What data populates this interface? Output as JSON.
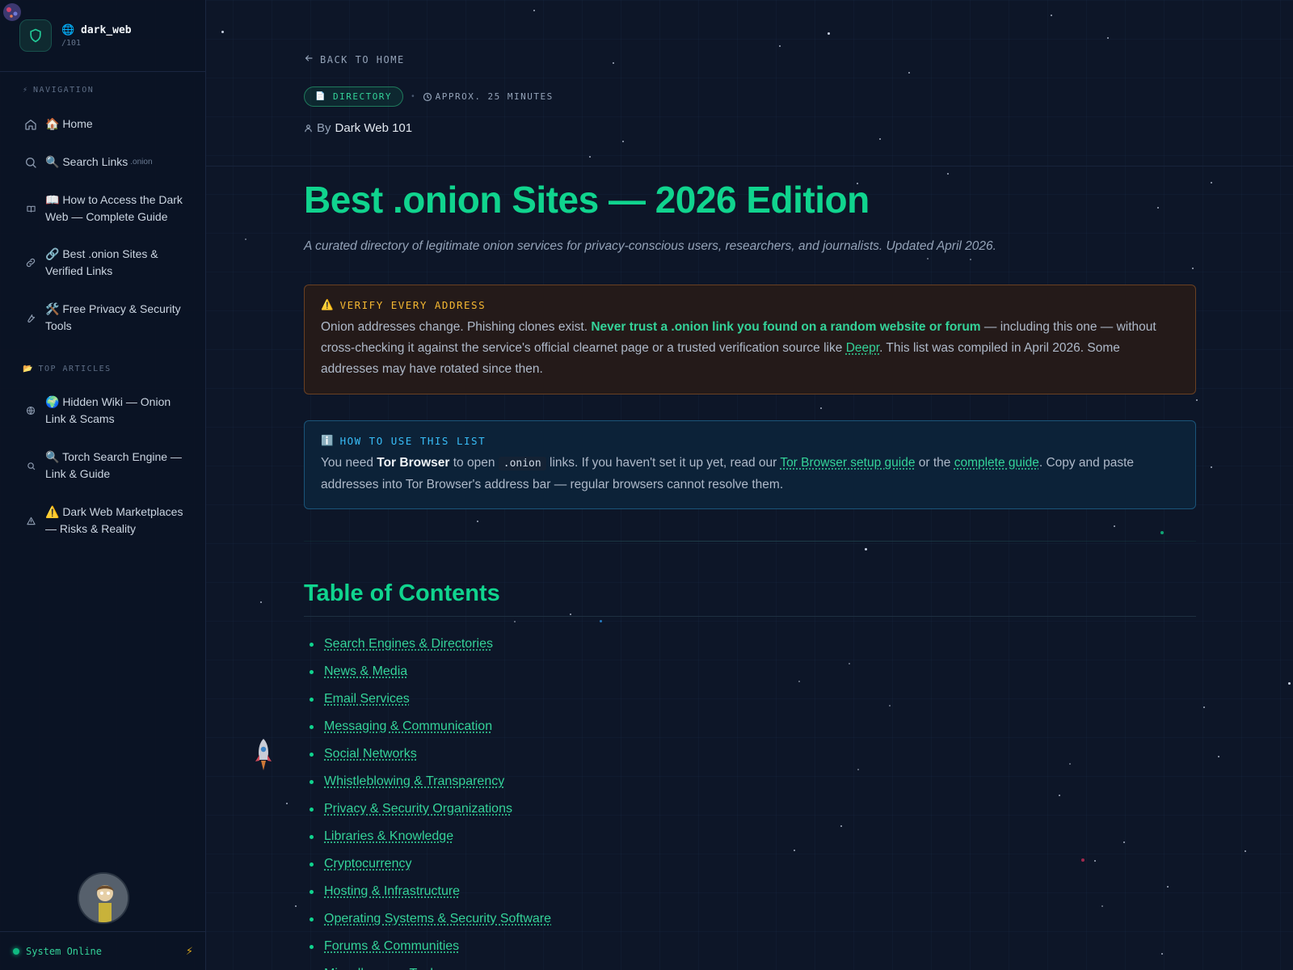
{
  "brand": {
    "globe_icon": "🌐",
    "name": "dark_web",
    "sub": "/101"
  },
  "sidebar": {
    "sections": [
      {
        "icon": "⚡",
        "label": "NAVIGATION"
      },
      {
        "icon": "📂",
        "label": "TOP ARTICLES"
      }
    ],
    "nav_items": [
      {
        "icon": "home-icon",
        "label": "🏠 Home"
      },
      {
        "icon": "search-icon",
        "label": "🔍 Search Links",
        "suffix": ".onion"
      },
      {
        "icon": "book-icon",
        "label": "📖 How to Access the Dark Web — Complete Guide"
      },
      {
        "icon": "link-icon",
        "label": "🔗 Best .onion Sites & Verified Links"
      },
      {
        "icon": "wrench-icon",
        "label": "🛠️ Free Privacy & Security Tools"
      }
    ],
    "articles": [
      {
        "icon": "globe-icon",
        "label": "🌍 Hidden Wiki — Onion Link & Scams"
      },
      {
        "icon": "search-icon",
        "label": "🔍 Torch Search Engine — Link & Guide"
      },
      {
        "icon": "warning-icon",
        "label": "⚠️ Dark Web Marketplaces — Risks & Reality"
      }
    ],
    "status": "System Online"
  },
  "main": {
    "back": "BACK TO HOME",
    "badge": "DIRECTORY",
    "reading_time": "APPROX. 25 MINUTES",
    "author_prefix": "By",
    "author": "Dark Web 101",
    "title": "Best .onion Sites — 2026 Edition",
    "subtitle": "A curated directory of legitimate onion services for privacy-conscious users, researchers, and journalists. Updated April 2026.",
    "warning": {
      "icon": "⚠️",
      "title": "VERIFY EVERY ADDRESS",
      "t1": "Onion addresses change. Phishing clones exist. ",
      "strong": "Never trust a .onion link you found on a random website or forum",
      "t2": " — including this one — without cross-checking it against the service's official clearnet page or a trusted verification source like ",
      "link": "Deepr",
      "t3": ". This list was compiled in April 2026. Some addresses may have rotated since then."
    },
    "info": {
      "icon": "ℹ️",
      "title": "HOW TO USE THIS LIST",
      "t1": "You need ",
      "strong": "Tor Browser",
      "t2": " to open ",
      "code": ".onion",
      "t3": " links. If you haven't set it up yet, read our ",
      "link1": "Tor Browser setup guide",
      "t4": " or the ",
      "link2": "complete guide",
      "t5": ". Copy and paste addresses into Tor Browser's address bar — regular browsers cannot resolve them."
    },
    "toc_title": "Table of Contents",
    "toc": [
      "Search Engines & Directories",
      "News & Media",
      "Email Services",
      "Messaging & Communication",
      "Social Networks",
      "Whistleblowing & Transparency",
      "Privacy & Security Organizations",
      "Libraries & Knowledge",
      "Cryptocurrency",
      "Hosting & Infrastructure",
      "Operating Systems & Security Software",
      "Forums & Communities",
      "Miscellaneous Tools"
    ]
  },
  "colors": {
    "accent": "#10d48e",
    "warning": "#f5b731",
    "info": "#38bdf8",
    "background": "#0d1628"
  }
}
